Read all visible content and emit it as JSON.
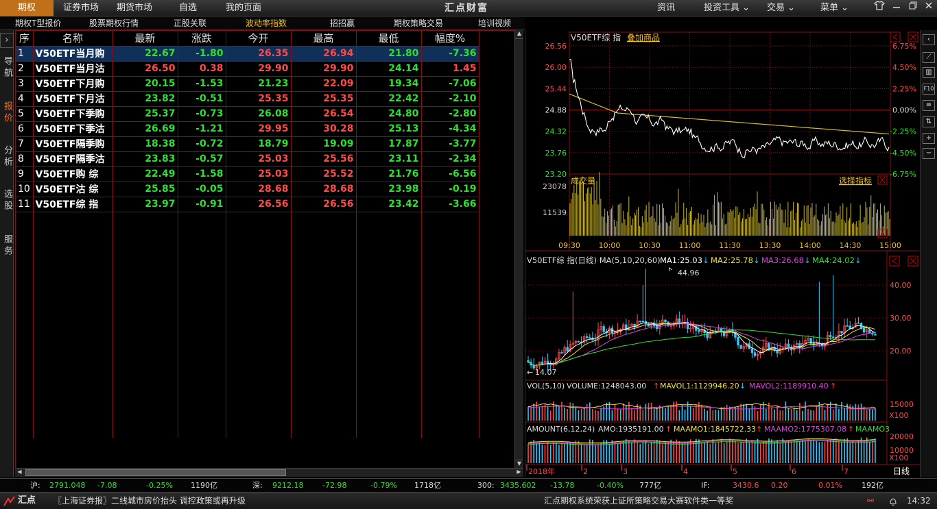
{
  "topbar": {
    "tabs": [
      {
        "label": "期权",
        "active": true
      },
      {
        "label": "证券市场",
        "active": false
      },
      {
        "label": "期货市场",
        "active": false
      },
      {
        "label": "自选",
        "active": false
      },
      {
        "label": "我的页面",
        "active": false
      }
    ],
    "brand": "汇点财富",
    "menus": [
      "资讯",
      "投资工具",
      "交易",
      "菜单"
    ],
    "window_icons": [
      "shirt-icon",
      "minimize-icon",
      "restore-icon",
      "close-icon"
    ]
  },
  "subtabs": [
    {
      "label": "期权T型报价",
      "active": false
    },
    {
      "label": "股票期权行情",
      "active": false
    },
    {
      "label": "正股关联",
      "active": false
    },
    {
      "label": "波动率指数",
      "active": true
    },
    {
      "label": "招招赢",
      "active": false
    },
    {
      "label": "期权策略交易",
      "active": false
    },
    {
      "label": "培训视频",
      "active": false
    }
  ],
  "leftnav": [
    {
      "label": "导航",
      "active": false
    },
    {
      "label": "报价",
      "active": true
    },
    {
      "label": "分析",
      "active": false
    },
    {
      "label": "选股",
      "active": false
    },
    {
      "label": "服务",
      "active": false
    }
  ],
  "quote_table": {
    "columns": [
      "序",
      "名称",
      "最新",
      "涨跌",
      "今开",
      "最高",
      "最低",
      "幅度%"
    ],
    "rows": [
      {
        "seq": "1",
        "name": "V50ETF当月购",
        "last": "22.67",
        "chg": "-1.80",
        "open": "26.35",
        "high": "26.94",
        "low": "21.80",
        "pct": "-7.36",
        "lc": "g",
        "cc": "g",
        "oc": "r",
        "hc": "r",
        "loc": "g",
        "pc": "g"
      },
      {
        "seq": "2",
        "name": "V50ETF当月沽",
        "last": "26.50",
        "chg": "0.38",
        "open": "29.90",
        "high": "29.90",
        "low": "24.14",
        "pct": "1.45",
        "lc": "r",
        "cc": "r",
        "oc": "r",
        "hc": "r",
        "loc": "g",
        "pc": "r"
      },
      {
        "seq": "3",
        "name": "V50ETF下月购",
        "last": "20.15",
        "chg": "-1.53",
        "open": "21.23",
        "high": "22.09",
        "low": "19.34",
        "pct": "-7.06",
        "lc": "g",
        "cc": "g",
        "oc": "g",
        "hc": "r",
        "loc": "g",
        "pc": "g"
      },
      {
        "seq": "4",
        "name": "V50ETF下月沽",
        "last": "23.82",
        "chg": "-0.51",
        "open": "25.35",
        "high": "25.35",
        "low": "22.42",
        "pct": "-2.10",
        "lc": "g",
        "cc": "g",
        "oc": "r",
        "hc": "r",
        "loc": "g",
        "pc": "g"
      },
      {
        "seq": "5",
        "name": "V50ETF下季购",
        "last": "25.37",
        "chg": "-0.73",
        "open": "26.08",
        "high": "26.54",
        "low": "24.80",
        "pct": "-2.80",
        "lc": "g",
        "cc": "g",
        "oc": "g",
        "hc": "r",
        "loc": "g",
        "pc": "g"
      },
      {
        "seq": "6",
        "name": "V50ETF下季沽",
        "last": "26.69",
        "chg": "-1.21",
        "open": "29.95",
        "high": "30.28",
        "low": "25.13",
        "pct": "-4.34",
        "lc": "g",
        "cc": "g",
        "oc": "r",
        "hc": "r",
        "loc": "g",
        "pc": "g"
      },
      {
        "seq": "7",
        "name": "V50ETF隔季购",
        "last": "18.38",
        "chg": "-0.72",
        "open": "18.79",
        "high": "19.09",
        "low": "17.87",
        "pct": "-3.77",
        "lc": "g",
        "cc": "g",
        "oc": "g",
        "hc": "g",
        "loc": "g",
        "pc": "g"
      },
      {
        "seq": "8",
        "name": "V50ETF隔季沽",
        "last": "23.83",
        "chg": "-0.57",
        "open": "25.03",
        "high": "25.56",
        "low": "23.11",
        "pct": "-2.34",
        "lc": "g",
        "cc": "g",
        "oc": "r",
        "hc": "r",
        "loc": "g",
        "pc": "g"
      },
      {
        "seq": "9",
        "name": "V50ETF购 综",
        "last": "22.49",
        "chg": "-1.58",
        "open": "25.03",
        "high": "25.52",
        "low": "21.76",
        "pct": "-6.56",
        "lc": "g",
        "cc": "g",
        "oc": "r",
        "hc": "r",
        "loc": "g",
        "pc": "g"
      },
      {
        "seq": "10",
        "name": "V50ETF沽 综",
        "last": "25.85",
        "chg": "-0.05",
        "open": "28.68",
        "high": "28.68",
        "low": "23.98",
        "pct": "-0.19",
        "lc": "g",
        "cc": "g",
        "oc": "r",
        "hc": "r",
        "loc": "g",
        "pc": "g"
      },
      {
        "seq": "11",
        "name": "V50ETF综 指",
        "last": "23.97",
        "chg": "-0.91",
        "open": "26.56",
        "high": "26.56",
        "low": "23.42",
        "pct": "-3.66",
        "lc": "g",
        "cc": "g",
        "oc": "r",
        "hc": "r",
        "loc": "g",
        "pc": "g"
      }
    ]
  },
  "intraday": {
    "title": "V50ETF综 指",
    "add_label": "叠加商品",
    "price_ticks": [
      "26.56",
      "26.00",
      "25.44",
      "24.88",
      "24.32",
      "23.76",
      "23.20"
    ],
    "pct_ticks": [
      "6.75%",
      "4.50%",
      "2.25%",
      "0.00%",
      "-2.25%",
      "-4.50%",
      "-6.75%"
    ],
    "vol_label": "成交量",
    "vol_select": "选择指标",
    "vol_ticks": [
      "23078",
      "11539"
    ],
    "times": [
      "09:30",
      "10:00",
      "10:30",
      "11:00",
      "11:30",
      "13:30",
      "14:00",
      "14:30",
      "15:00"
    ]
  },
  "daily": {
    "ma_title": "V50ETF综  指(日线)  MA(5,10,20,60)",
    "ma1": "MA1:25.03",
    "ma2": "MA2:25.78",
    "ma3": "MA3:26.68",
    "ma4": "MA4:24.02",
    "ticks": [
      "40.00",
      "30.00",
      "20.00"
    ],
    "peak_label": "44.96",
    "low_label": "14.07",
    "vol_title": "VOL(5,10)",
    "vol_value": "VOLUME:1248043.00",
    "mavol1": "MAVOL1:1129946.20",
    "mavol2": "MAVOL2:1189910.40",
    "vol_tick": "15000",
    "vol_unit": "X100",
    "amo_title": "AMOUNT(6,12,24)",
    "amo_value": "AMO:1935191.00",
    "maamo1": "MAAMO1:1845722.33",
    "maamo2": "MAAMO2:1775307.08",
    "maamo3": "MAAMO3",
    "amo_ticks": [
      "20000",
      "10000"
    ],
    "amo_unit": "X100",
    "date_labels": [
      "2018年",
      "2",
      "3",
      "4",
      "5",
      "6",
      "7"
    ],
    "period": "日线"
  },
  "status": {
    "sh_label": "沪:",
    "sh_index": "2791.048",
    "sh_chg": "-7.08",
    "sh_pct": "-0.25%",
    "sh_amt": "1190亿",
    "sz_label": "深:",
    "sz_index": "9212.18",
    "sz_chg": "-72.98",
    "sz_pct": "-0.79%",
    "sz_amt": "1718亿",
    "hs_label": "300:",
    "hs_index": "3435.602",
    "hs_chg": "-13.78",
    "hs_pct": "-0.40%",
    "hs_amt": "777亿",
    "if_label": "IF:",
    "if_index": "3430.6",
    "if_chg": "0.20",
    "if_pct": "0.01%",
    "if_amt": "192亿"
  },
  "news": {
    "logo": "汇点",
    "headline": "〖上海证券报〗二线城市房价抬头 调控政策或再升级",
    "notice": "汇点期权系统荣获上证所策略交易大赛软件类一等奖",
    "clock": "14:32"
  },
  "colors": {
    "up": "#ff4a4a",
    "down": "#30e030",
    "accent": "#c07018",
    "grid": "#8a1010",
    "highlight": "#f0c020"
  }
}
